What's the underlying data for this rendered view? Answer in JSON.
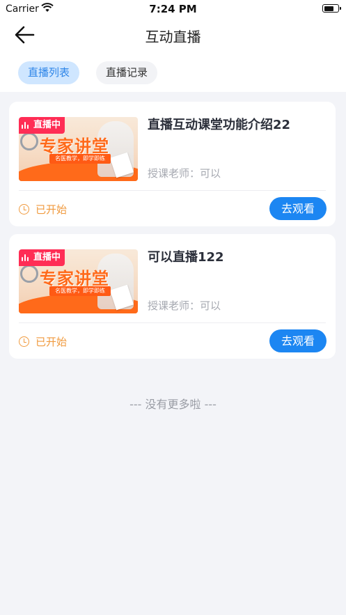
{
  "status_bar": {
    "carrier": "Carrier",
    "time": "7:24 PM"
  },
  "nav": {
    "title": "互动直播",
    "back_icon": "arrow-left-icon"
  },
  "tabs": [
    {
      "label": "直播列表",
      "active": true
    },
    {
      "label": "直播记录",
      "active": false
    }
  ],
  "colors": {
    "accent": "#1c86f2",
    "tab_active_bg": "#cfe6ff",
    "live_badge": "#ff2d55",
    "status_orange": "#f09a3e",
    "background": "#f3f4f8"
  },
  "courses": [
    {
      "title": "直播互动课堂功能介绍22",
      "badge": "直播中",
      "thumb_title": "专家讲堂",
      "thumb_subtitle": "名医教学，即学即练",
      "teacher": "授课老师：可以",
      "status": "已开始",
      "action": "去观看"
    },
    {
      "title": "可以直播122",
      "badge": "直播中",
      "thumb_title": "专家讲堂",
      "thumb_subtitle": "名医教学，即学即练",
      "teacher": "授课老师：可以",
      "status": "已开始",
      "action": "去观看"
    }
  ],
  "footer": {
    "no_more": "--- 没有更多啦 ---"
  }
}
